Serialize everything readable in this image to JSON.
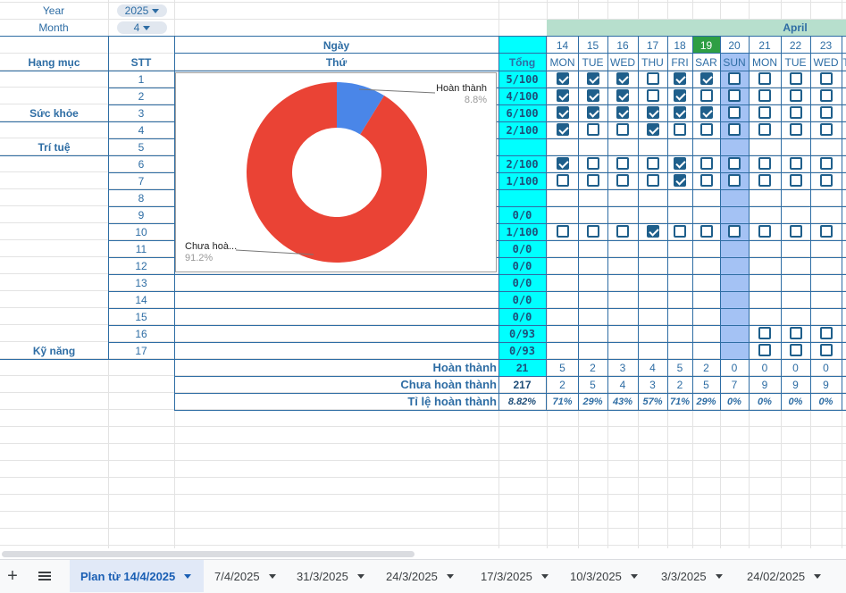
{
  "filters": {
    "year_label": "Year",
    "year_value": "2025",
    "month_label": "Month",
    "month_value": "4"
  },
  "headers": {
    "ngay": "Ngày",
    "thu": "Thứ",
    "hang_muc": "Hạng mục",
    "stt": "STT",
    "tong": "Tổng",
    "month_name": "April"
  },
  "categories": [
    "Sức khỏe",
    "Trí tuệ",
    "Kỹ năng"
  ],
  "days": [
    {
      "date": "14",
      "dow": "MON"
    },
    {
      "date": "15",
      "dow": "TUE"
    },
    {
      "date": "16",
      "dow": "WED"
    },
    {
      "date": "17",
      "dow": "THU"
    },
    {
      "date": "18",
      "dow": "FRI"
    },
    {
      "date": "19",
      "dow": "SAR"
    },
    {
      "date": "20",
      "dow": "SUN"
    },
    {
      "date": "21",
      "dow": "MON"
    },
    {
      "date": "22",
      "dow": "TUE"
    },
    {
      "date": "23",
      "dow": "WED"
    },
    {
      "date": "",
      "dow": "T"
    }
  ],
  "rows": [
    {
      "stt": "1",
      "total": "5/100",
      "checks": [
        1,
        1,
        1,
        0,
        1,
        1,
        0,
        0,
        0,
        0
      ]
    },
    {
      "stt": "2",
      "total": "4/100",
      "checks": [
        1,
        1,
        1,
        0,
        1,
        0,
        0,
        0,
        0,
        0
      ]
    },
    {
      "stt": "3",
      "total": "6/100",
      "checks": [
        1,
        1,
        1,
        1,
        1,
        1,
        0,
        0,
        0,
        0
      ]
    },
    {
      "stt": "4",
      "total": "2/100",
      "checks": [
        1,
        0,
        0,
        1,
        0,
        0,
        0,
        0,
        0,
        0
      ]
    },
    {
      "stt": "5",
      "total": "",
      "checks": null
    },
    {
      "stt": "6",
      "total": "2/100",
      "checks": [
        1,
        0,
        0,
        0,
        1,
        0,
        0,
        0,
        0,
        0
      ]
    },
    {
      "stt": "7",
      "total": "1/100",
      "checks": [
        0,
        0,
        0,
        0,
        1,
        0,
        0,
        0,
        0,
        0
      ]
    },
    {
      "stt": "8",
      "total": "",
      "checks": null
    },
    {
      "stt": "9",
      "total": "0/0",
      "checks": null
    },
    {
      "stt": "10",
      "total": "1/100",
      "checks": [
        0,
        0,
        0,
        1,
        0,
        0,
        0,
        0,
        0,
        0
      ]
    },
    {
      "stt": "11",
      "total": "0/0",
      "checks": null
    },
    {
      "stt": "12",
      "total": "0/0",
      "checks": null
    },
    {
      "stt": "13",
      "total": "0/0",
      "checks": null
    },
    {
      "stt": "14",
      "total": "0/0",
      "checks": null
    },
    {
      "stt": "15",
      "total": "0/0",
      "checks": null
    },
    {
      "stt": "16",
      "total": "0/93",
      "checks": "late"
    },
    {
      "stt": "17",
      "total": "0/93",
      "checks": "late"
    }
  ],
  "summary": {
    "done_label": "Hoàn thành",
    "done_total": "21",
    "done_days": [
      "5",
      "2",
      "3",
      "4",
      "5",
      "2",
      "0",
      "0",
      "0",
      "0"
    ],
    "undone_label": "Chưa hoàn thành",
    "undone_total": "217",
    "undone_days": [
      "2",
      "5",
      "4",
      "3",
      "2",
      "5",
      "7",
      "9",
      "9",
      "9"
    ],
    "rate_label": "Tỉ lệ hoàn thành",
    "rate_total": "8.82%",
    "rate_days": [
      "71%",
      "29%",
      "43%",
      "57%",
      "71%",
      "29%",
      "0%",
      "0%",
      "0%",
      "0%"
    ]
  },
  "chart_data": {
    "type": "pie",
    "donut": true,
    "slices": [
      {
        "label": "Hoàn thành",
        "value": 8.8,
        "pct_label": "8.8%",
        "color": "#4a86e8"
      },
      {
        "label": "Chưa hoà...",
        "value": 91.2,
        "pct_label": "91.2%",
        "color": "#ea4335"
      }
    ]
  },
  "tabs": [
    "Plan từ 14/4/2025",
    "7/4/2025",
    "31/3/2025",
    "24/3/2025",
    "17/3/2025",
    "10/3/2025",
    "3/3/2025",
    "24/02/2025"
  ],
  "colors": {
    "accent_cyan": "#00ffff",
    "header_green": "#b7dfcd",
    "today_green": "#2e9e44",
    "sunday_blue": "#a4c2f4",
    "text_blue": "#2e6da4"
  }
}
